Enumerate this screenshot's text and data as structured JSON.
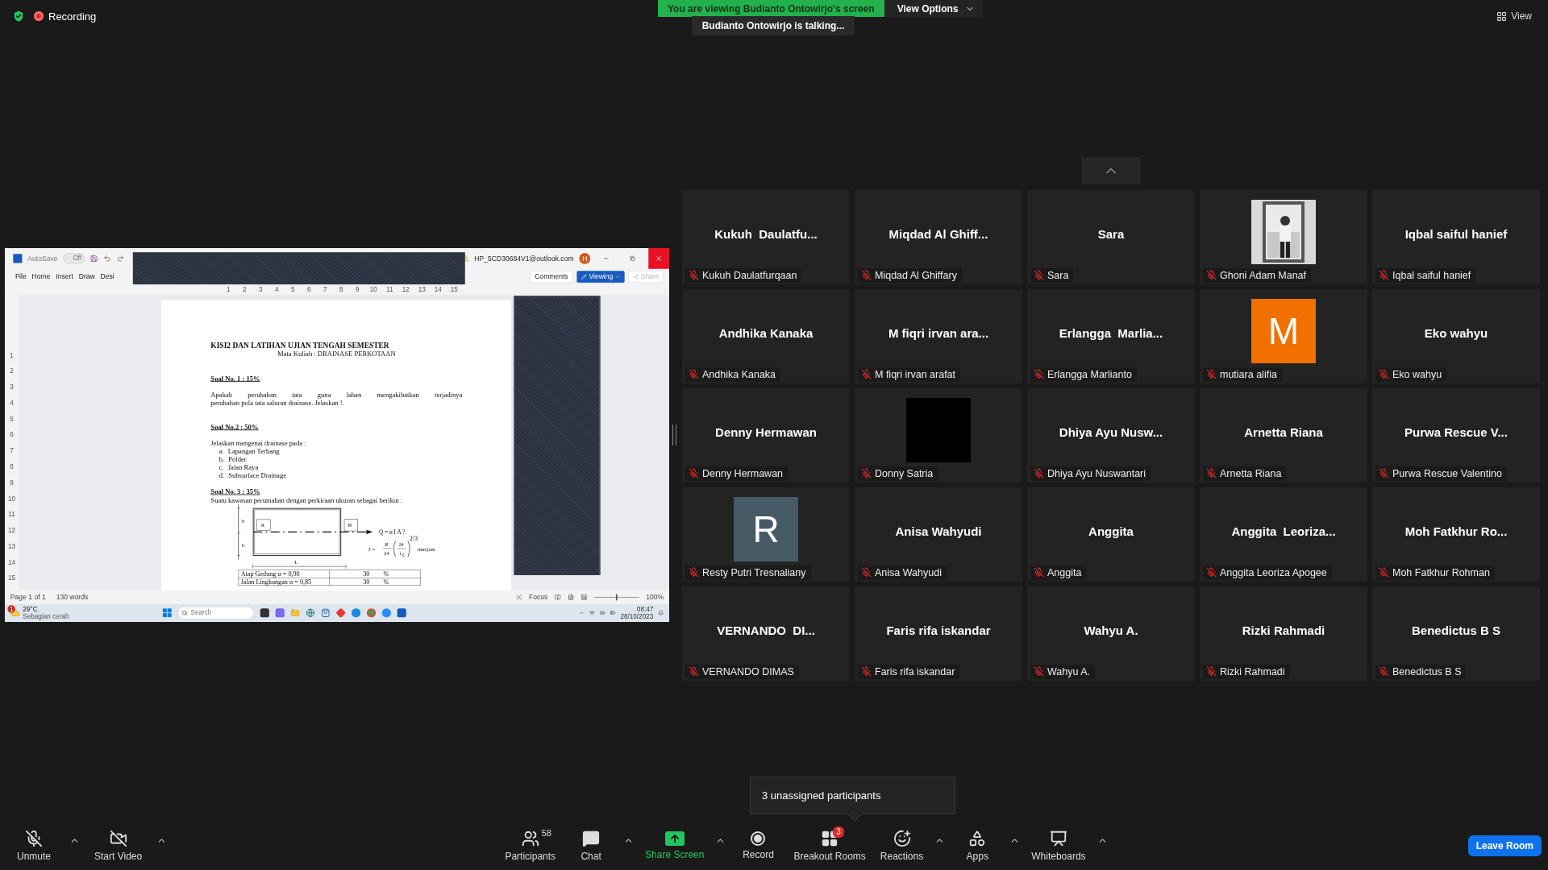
{
  "top_bar": {
    "recording": "Recording",
    "banner": "You are viewing Budianto Ontowirjo's screen",
    "view_options": "View Options",
    "talking": "Budianto Ontowirjo is talking...",
    "view": "View"
  },
  "shared_screen": {
    "title_bar": {
      "autosave": "AutoSave",
      "autosave_on": false,
      "toggle_text": "Off",
      "account": "HP_5CD30684V1@outlook.com",
      "avatar": "H"
    },
    "ribbon_tabs": [
      "File",
      "Home",
      "Insert",
      "Draw",
      "Desi"
    ],
    "ribbon_buttons": {
      "comments": "Comments",
      "viewing": "Viewing",
      "share": "Share"
    },
    "ruler_marks": [
      "1",
      "2",
      "3",
      "4",
      "5",
      "6",
      "7",
      "8",
      "9",
      "10",
      "11",
      "12",
      "13",
      "14",
      "15"
    ],
    "vertical_ruler_marks": [
      "1",
      "2",
      "3",
      "4",
      "5",
      "6",
      "7",
      "8",
      "9",
      "10",
      "11",
      "12",
      "13",
      "14",
      "15"
    ],
    "document": {
      "title": "KISI2 DAN LATIHAN UJIAN TENGAH SEMESTER",
      "subtitle": "Mata Kuliah :  DRAINASE PERKOTAAN",
      "sections": [
        {
          "heading": "Soal No. 1 : 15%",
          "lines": [
            "Apakah perubahan tata guna lahan mengakibatkan terjadinya",
            "perubahan pola tata saluran drainase.  Jelaskan !."
          ]
        },
        {
          "heading": "Soal  No.2 : 50%",
          "lines": [
            "Jelaskan mengenai drainase pada :"
          ],
          "list": [
            {
              "marker": "a.",
              "text": "Lapangan Terbang"
            },
            {
              "marker": "b.",
              "text": "Polder"
            },
            {
              "marker": "c.",
              "text": "Jalan Raya"
            },
            {
              "marker": "d.",
              "text": "Subsurface Drainage"
            }
          ]
        },
        {
          "heading": "Soal No. 3 : 35%",
          "lines": [
            "Suatu kawasan perumahan dengan perkiraan ukuran sebagai berikut :"
          ],
          "diagram": {
            "box_a": "A",
            "box_b": "B",
            "side_labels": [
              "b",
              "b"
            ],
            "length_label": "L",
            "equation": "Q = α I A ?",
            "formula": {
              "lhs": "I =",
              "num1": "R",
              "den1": "24",
              "num2": "24",
              "den2": "t",
              "den2_sub": "c",
              "exponent": "2/3",
              "unit": "mm/jam"
            }
          },
          "table": [
            {
              "label": "Atap Gedung α = 0,90",
              "value": "30",
              "unit": "%"
            },
            {
              "label": "Jalan Lingkungan α = 0,85",
              "value": "30",
              "unit": "%"
            }
          ]
        }
      ]
    },
    "status_bar": {
      "page": "Page 1 of 1",
      "words": "130 words",
      "focus": "Focus",
      "zoom_slider": {
        "level": 0.5
      },
      "zoom": "100%"
    },
    "taskbar": {
      "weather_badge": "1",
      "temperature": "29°C",
      "weather": "Sebagian cerah",
      "search_placeholder": "Search",
      "time": "08:47",
      "date": "28/10/2023"
    }
  },
  "participants": [
    {
      "kind": "name",
      "display": "Kukuh  Daulatfu...",
      "name": "Kukuh Daulatfurqaan",
      "muted": true
    },
    {
      "kind": "name",
      "display": "Miqdad Al Ghiff...",
      "name": "Miqdad Al Ghiffary",
      "muted": true
    },
    {
      "kind": "name",
      "display": "Sara",
      "name": "Sara",
      "muted": true
    },
    {
      "name": "Ghoni Adam Manaf",
      "muted": true
    },
    {
      "kind": "name",
      "display": "Iqbal saiful hanief",
      "name": "Iqbal saiful hanief",
      "muted": true
    },
    {
      "kind": "name",
      "display": "Andhika Kanaka",
      "name": "Andhika Kanaka",
      "muted": true
    },
    {
      "kind": "name",
      "display": "M fiqri irvan ara...",
      "name": "M fiqri irvan arafat",
      "muted": true
    },
    {
      "kind": "name",
      "display": "Erlangga  Marlia...",
      "name": "Erlangga Marlianto",
      "muted": true
    },
    {
      "kind": "letter",
      "letter": "M",
      "color": "#f07000",
      "name": "mutiara alifia",
      "muted": true
    },
    {
      "kind": "name",
      "display": "Eko wahyu",
      "name": "Eko wahyu",
      "muted": true
    },
    {
      "kind": "name",
      "display": "Denny Hermawan",
      "name": "Denny Hermawan",
      "muted": true
    },
    {
      "kind": "video_off",
      "name": "Donny Satria",
      "muted": true
    },
    {
      "kind": "name",
      "display": "Dhiya Ayu Nusw...",
      "name": "Dhiya Ayu Nuswantari",
      "muted": true
    },
    {
      "kind": "name",
      "display": "Arnetta Riana",
      "name": "Arnetta Riana",
      "muted": true
    },
    {
      "kind": "name",
      "display": "Purwa Rescue V...",
      "name": "Purwa Rescue Valentino",
      "muted": true
    },
    {
      "kind": "letter",
      "letter": "R",
      "color": "#455a64",
      "name": "Resty Putri Tresnaliany",
      "muted": true
    },
    {
      "kind": "name",
      "display": "Anisa Wahyudi",
      "name": "Anisa Wahyudi",
      "muted": true
    },
    {
      "kind": "name",
      "display": "Anggita",
      "name": "Anggita",
      "muted": true
    },
    {
      "kind": "name",
      "display": "Anggita  Leoriza...",
      "name": "Anggita Leoriza Apogee",
      "muted": true
    },
    {
      "kind": "name",
      "display": "Moh Fatkhur Ro...",
      "name": "Moh Fatkhur Rohman",
      "muted": true
    },
    {
      "kind": "name",
      "display": "VERNANDO  DI...",
      "name": "VERNANDO DIMAS",
      "muted": true
    },
    {
      "kind": "name",
      "display": "Faris rifa iskandar",
      "name": "Faris rifa iskandar",
      "muted": true
    },
    {
      "kind": "name",
      "display": "Wahyu A.",
      "name": "Wahyu A.",
      "muted": true
    },
    {
      "kind": "name",
      "display": "Rizki Rahmadi",
      "name": "Rizki Rahmadi",
      "muted": true
    },
    {
      "kind": "name",
      "display": "Benedictus B S",
      "name": "Benedictus B S",
      "muted": true
    }
  ],
  "unassigned_popup": "3 unassigned participants",
  "toolbar": {
    "left": [
      {
        "kind": "audio",
        "label": "Unmute",
        "caret": true
      },
      {
        "kind": "video",
        "label": "Start Video",
        "caret": true
      }
    ],
    "center": [
      {
        "kind": "participants",
        "label": "Participants",
        "count": "58"
      },
      {
        "kind": "chat",
        "label": "Chat",
        "caret": true
      },
      {
        "kind": "share",
        "label": "Share Screen",
        "caret": true
      },
      {
        "kind": "record",
        "label": "Record"
      },
      {
        "kind": "breakout",
        "label": "Breakout Rooms",
        "badge": "3"
      },
      {
        "kind": "reactions",
        "label": "Reactions",
        "caret": true
      },
      {
        "kind": "apps",
        "label": "Apps",
        "caret": true
      },
      {
        "kind": "whiteboards",
        "label": "Whiteboards",
        "caret": true
      }
    ],
    "leave": "Leave Room"
  }
}
